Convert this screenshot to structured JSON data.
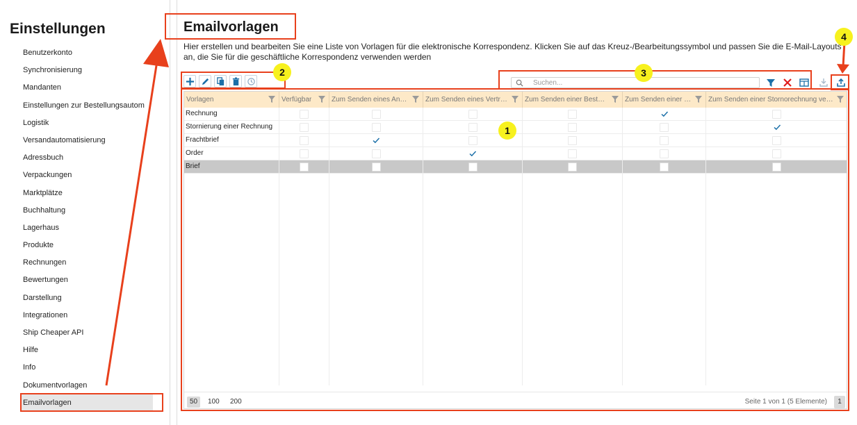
{
  "sidebar": {
    "title": "Einstellungen",
    "items": [
      {
        "label": "Benutzerkonto"
      },
      {
        "label": "Synchronisierung"
      },
      {
        "label": "Mandanten"
      },
      {
        "label": "Einstellungen zur Bestellungsautom"
      },
      {
        "label": "Logistik"
      },
      {
        "label": "Versandautomatisierung"
      },
      {
        "label": "Adressbuch"
      },
      {
        "label": "Verpackungen"
      },
      {
        "label": "Marktplätze"
      },
      {
        "label": "Buchhaltung"
      },
      {
        "label": "Lagerhaus"
      },
      {
        "label": "Produkte"
      },
      {
        "label": "Rechnungen"
      },
      {
        "label": "Bewertungen"
      },
      {
        "label": "Darstellung"
      },
      {
        "label": "Integrationen"
      },
      {
        "label": "Ship Cheaper API"
      },
      {
        "label": "Hilfe"
      },
      {
        "label": "Info"
      },
      {
        "label": "Dokumentvorlagen"
      },
      {
        "label": "Emailvorlagen",
        "active": true
      }
    ]
  },
  "main": {
    "title": "Emailvorlagen",
    "description": "Hier erstellen und bearbeiten Sie eine Liste von Vorlagen für die elektronische Korrespondenz. Klicken Sie auf das Kreuz-/Bearbeitungssymbol und passen Sie die E-Mail-Layouts an, die Sie für die geschäftliche Korrespondenz verwenden werden"
  },
  "toolbar": {
    "buttons": [
      {
        "name": "add-button",
        "icon": "plus-icon"
      },
      {
        "name": "edit-button",
        "icon": "pencil-icon"
      },
      {
        "name": "copy-button",
        "icon": "copy-icon"
      },
      {
        "name": "delete-button",
        "icon": "trash-icon"
      },
      {
        "name": "history-button",
        "icon": "history-icon"
      }
    ]
  },
  "search": {
    "placeholder": "Suchen..."
  },
  "grid": {
    "columns": [
      {
        "label": "Vorlagen"
      },
      {
        "label": "Verfügbar"
      },
      {
        "label": "Zum Senden eines Angebots"
      },
      {
        "label": "Zum Senden eines Vertrags"
      },
      {
        "label": "Zum Senden einer Bestellung"
      },
      {
        "label": "Zum Senden einer Rechnung"
      },
      {
        "label": "Zum Senden einer Stornorechnung verwenden"
      }
    ],
    "rows": [
      {
        "name": "Rechnung",
        "checks": [
          false,
          false,
          false,
          false,
          true,
          false
        ]
      },
      {
        "name": "Stornierung einer Rechnung",
        "checks": [
          false,
          false,
          false,
          false,
          false,
          true
        ]
      },
      {
        "name": "Frachtbrief",
        "checks": [
          false,
          true,
          false,
          false,
          false,
          false
        ]
      },
      {
        "name": "Order",
        "checks": [
          false,
          false,
          true,
          false,
          false,
          false
        ]
      },
      {
        "name": "Brief",
        "checks": [
          false,
          false,
          false,
          false,
          false,
          false
        ],
        "selected": true
      }
    ]
  },
  "pagination": {
    "sizes": [
      "50",
      "100",
      "200"
    ],
    "active_size": "50",
    "info": "Seite 1 von 1 (5 Elemente)",
    "page": "1"
  },
  "annotations": {
    "badges": [
      "1",
      "2",
      "3",
      "4"
    ]
  },
  "colors": {
    "accent": "#1a6fa8",
    "header_bg": "#fde9c8",
    "annotation_red": "#e8401c",
    "badge_yellow": "#f7f11e",
    "delete_red": "#e01b1b"
  }
}
